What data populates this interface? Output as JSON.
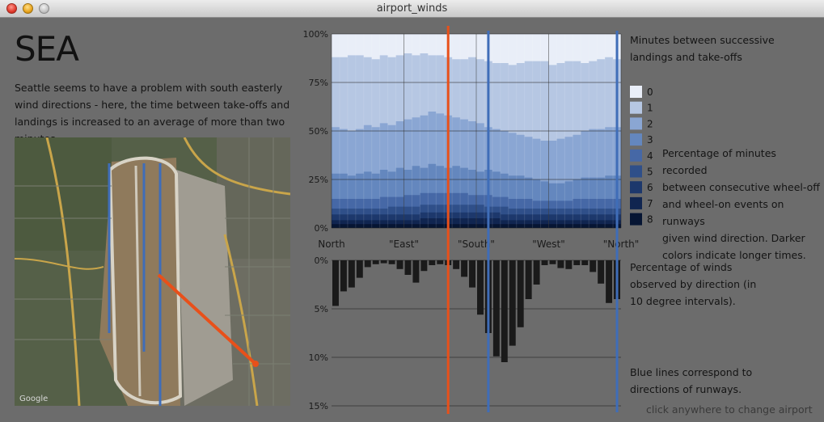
{
  "window": {
    "title": "airport_winds"
  },
  "airport_code": "SEA",
  "description": "Seattle seems to have a problem with south easterly wind directions - here, the time between take-offs and landings is increased to an average of more than two minutes.",
  "map": {
    "watermark": "Google"
  },
  "texts": {
    "minutes_title": [
      "Minutes between successive",
      "landings and take-offs"
    ],
    "percentage_minutes": [
      "Percentage of minutes recorded",
      "between consecutive wheel-off",
      "and wheel-on events on runways",
      "given wind direction. Darker",
      "colors indicate longer times."
    ],
    "percentage_winds": [
      "Percentage of winds",
      "observed by direction (in",
      "10 degree intervals)."
    ],
    "blue_lines": [
      "Blue lines correspond to",
      "directions of runways."
    ],
    "hint": "click anywhere to change airport"
  },
  "colors": {
    "background": "#6c6c6c",
    "selected_direction": "#e8501a",
    "runway": "#3f6db8",
    "bar": "#1a1a1a",
    "legend": [
      "#e9eef8",
      "#b6c7e3",
      "#8aa6d3",
      "#6487be",
      "#4668a6",
      "#2f4f89",
      "#1d386c",
      "#102550",
      "#061533"
    ]
  },
  "chart_data": [
    {
      "type": "area",
      "stacked": true,
      "normalized": true,
      "x_unit": "wind direction (10 degree intervals)",
      "x_labels": [
        "North",
        "\"East\"",
        "\"South\"",
        "\"West\"",
        "\"North\""
      ],
      "y_ticks": [
        "100%",
        "75%",
        "50%",
        "25%",
        "0%"
      ],
      "ylim": [
        0,
        100
      ],
      "grid": true,
      "legend_title": "Minutes between successive landings and take-offs",
      "legend": [
        "0",
        "1",
        "2",
        "3",
        "4",
        "5",
        "6",
        "7",
        "8"
      ],
      "cumulative_boundaries_percent": {
        "8": [
          2,
          2,
          2,
          2,
          2,
          2,
          2,
          2,
          2,
          2,
          2,
          2,
          2,
          2,
          2,
          2,
          2,
          2,
          2,
          2,
          2,
          2,
          2,
          2,
          2,
          2,
          2,
          2,
          2,
          2,
          2,
          2,
          2,
          2,
          2,
          2
        ],
        "7": [
          4,
          4,
          4,
          4,
          4,
          4,
          4,
          4,
          4,
          4,
          4,
          5,
          5,
          5,
          5,
          5,
          5,
          5,
          5,
          5,
          5,
          4,
          4,
          4,
          4,
          4,
          4,
          4,
          4,
          4,
          4,
          4,
          4,
          4,
          4,
          4
        ],
        "6": [
          7,
          7,
          7,
          7,
          7,
          7,
          7,
          7,
          7,
          7,
          7,
          8,
          8,
          8,
          8,
          8,
          8,
          8,
          8,
          8,
          8,
          7,
          7,
          7,
          7,
          7,
          7,
          7,
          7,
          7,
          7,
          7,
          7,
          7,
          7,
          7
        ],
        "5": [
          10,
          10,
          10,
          10,
          10,
          10,
          10,
          11,
          11,
          11,
          11,
          12,
          12,
          12,
          12,
          12,
          12,
          12,
          12,
          11,
          11,
          11,
          10,
          10,
          10,
          10,
          10,
          10,
          10,
          10,
          10,
          10,
          10,
          10,
          10,
          10
        ],
        "4": [
          15,
          15,
          15,
          15,
          15,
          15,
          16,
          16,
          16,
          17,
          17,
          18,
          18,
          18,
          18,
          18,
          18,
          17,
          17,
          17,
          16,
          16,
          15,
          15,
          15,
          14,
          14,
          14,
          14,
          14,
          15,
          15,
          15,
          15,
          15,
          15
        ],
        "3": [
          28,
          28,
          27,
          28,
          29,
          28,
          30,
          29,
          31,
          30,
          32,
          31,
          33,
          32,
          31,
          32,
          31,
          30,
          29,
          30,
          29,
          28,
          27,
          27,
          26,
          25,
          24,
          23,
          23,
          24,
          25,
          26,
          26,
          26,
          27,
          27
        ],
        "2": [
          52,
          51,
          50,
          51,
          53,
          52,
          54,
          53,
          55,
          56,
          57,
          58,
          60,
          59,
          58,
          57,
          56,
          55,
          54,
          52,
          51,
          50,
          49,
          48,
          47,
          46,
          45,
          45,
          46,
          47,
          48,
          50,
          51,
          51,
          52,
          52
        ],
        "1": [
          88,
          88,
          89,
          89,
          88,
          87,
          89,
          88,
          89,
          90,
          89,
          90,
          89,
          89,
          88,
          87,
          87,
          88,
          87,
          86,
          85,
          85,
          84,
          85,
          86,
          86,
          86,
          84,
          85,
          86,
          86,
          85,
          86,
          87,
          88,
          87
        ],
        "0": [
          100,
          100,
          100,
          100,
          100,
          100,
          100,
          100,
          100,
          100,
          100,
          100,
          100,
          100,
          100,
          100,
          100,
          100,
          100,
          100,
          100,
          100,
          100,
          100,
          100,
          100,
          100,
          100,
          100,
          100,
          100,
          100,
          100,
          100,
          100,
          100
        ]
      },
      "selected_direction_index": 14.5,
      "runway_direction_indices": [
        19.5,
        35.5
      ]
    },
    {
      "type": "bar",
      "orientation": "downward",
      "title": "Percentage of winds observed by direction (in 10 degree intervals).",
      "y_ticks": [
        "0%",
        "5%",
        "10%",
        "15%"
      ],
      "ylim": [
        0,
        15
      ],
      "grid": true,
      "values": [
        4.7,
        3.2,
        2.8,
        1.8,
        0.7,
        0.4,
        0.3,
        0.4,
        0.9,
        1.5,
        2.3,
        1.1,
        0.5,
        0.4,
        0.5,
        0.9,
        1.7,
        2.8,
        5.6,
        7.5,
        9.9,
        10.5,
        8.8,
        6.9,
        4.0,
        2.5,
        0.5,
        0.4,
        0.8,
        0.9,
        0.5,
        0.5,
        1.2,
        2.4,
        4.4,
        4.0
      ]
    }
  ]
}
